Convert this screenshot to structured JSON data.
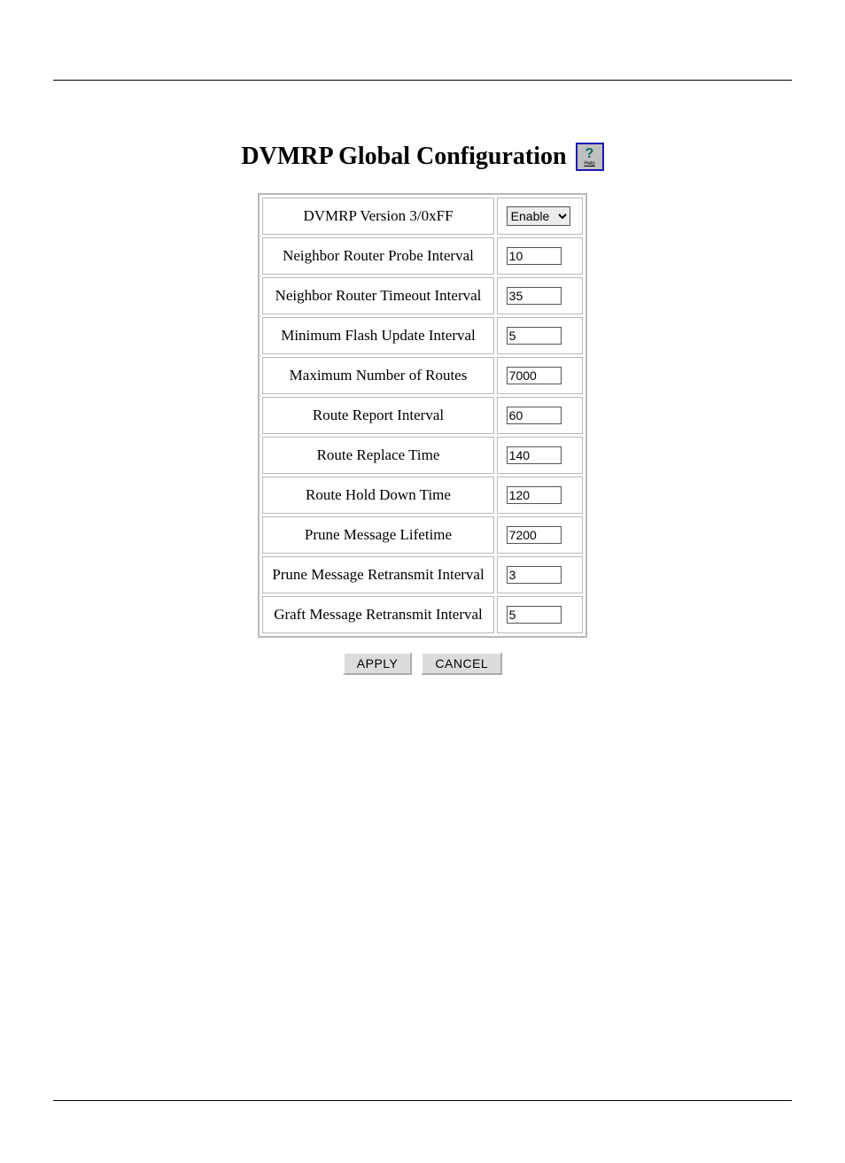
{
  "header": {
    "title": "DVMRP Global Configuration",
    "help_label": "Help"
  },
  "form": {
    "rows": [
      {
        "label": "DVMRP Version 3/0xFF",
        "value": "Enable",
        "type": "select"
      },
      {
        "label": "Neighbor Router Probe Interval",
        "value": "10",
        "type": "text"
      },
      {
        "label": "Neighbor Router Timeout Interval",
        "value": "35",
        "type": "text"
      },
      {
        "label": "Minimum Flash Update Interval",
        "value": "5",
        "type": "text"
      },
      {
        "label": "Maximum Number of Routes",
        "value": "7000",
        "type": "text"
      },
      {
        "label": "Route Report Interval",
        "value": "60",
        "type": "text"
      },
      {
        "label": "Route Replace Time",
        "value": "140",
        "type": "text"
      },
      {
        "label": "Route Hold Down Time",
        "value": "120",
        "type": "text"
      },
      {
        "label": "Prune Message Lifetime",
        "value": "7200",
        "type": "text"
      },
      {
        "label": "Prune Message Retransmit Interval",
        "value": "3",
        "type": "text"
      },
      {
        "label": "Graft Message Retransmit Interval",
        "value": "5",
        "type": "text"
      }
    ]
  },
  "buttons": {
    "apply": "APPLY",
    "cancel": "CANCEL"
  }
}
